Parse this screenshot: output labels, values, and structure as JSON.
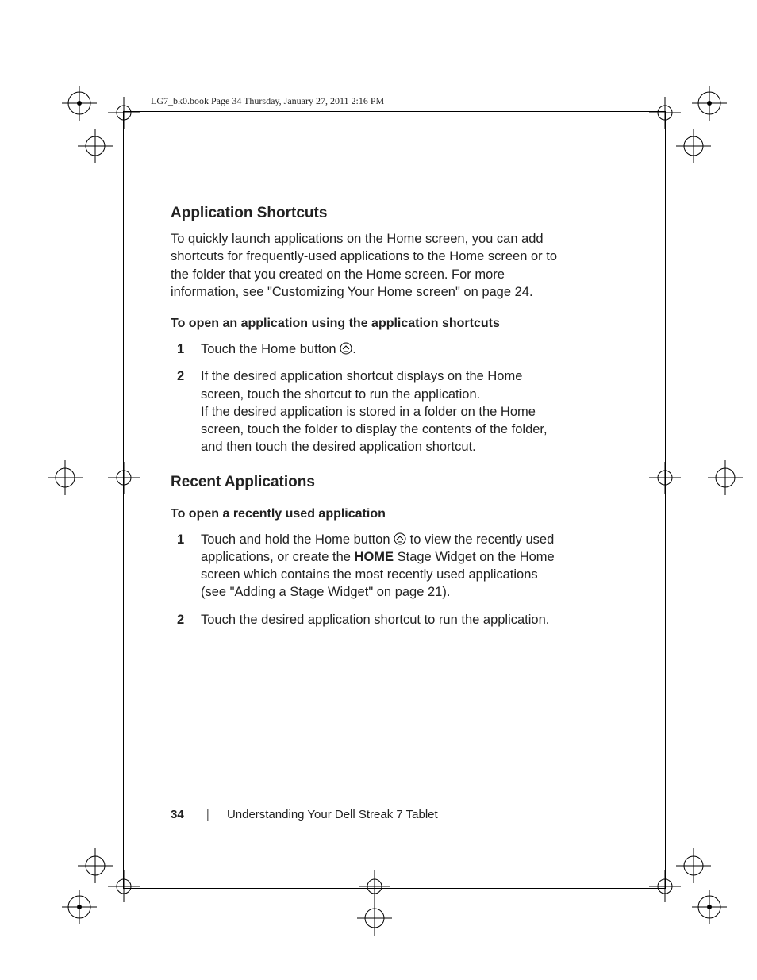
{
  "running_header": "LG7_bk0.book  Page 34  Thursday, January 27, 2011  2:16 PM",
  "sections": {
    "app_shortcuts": {
      "heading": "Application Shortcuts",
      "intro": "To quickly launch applications on the Home screen, you can add shortcuts for frequently-used applications to the Home screen or to the folder that you created on the Home screen. For more information, see \"Customizing Your Home screen\" on page 24.",
      "sub1": {
        "heading": "To open an application using the application shortcuts",
        "steps": [
          {
            "num": "1",
            "pre": "Touch the Home button ",
            "post": "."
          },
          {
            "num": "2",
            "para1": "If the desired application shortcut displays on the Home screen, touch the shortcut to run the application.",
            "para2": "If the desired application is stored in a folder on the Home screen, touch the folder to display the contents of the folder, and then touch the desired application shortcut."
          }
        ]
      }
    },
    "recent_apps": {
      "heading": "Recent Applications",
      "sub1": {
        "heading": "To open a recently used application",
        "steps": [
          {
            "num": "1",
            "pre": "Touch and hold the Home button ",
            "post_a": " to view the recently used applications, or create the ",
            "bold": "HOME",
            "post_b": " Stage Widget on the Home screen which contains the most recently used applications (see \"Adding a Stage Widget\" on page 21)."
          },
          {
            "num": "2",
            "text": "Touch the desired application shortcut to run the application."
          }
        ]
      }
    }
  },
  "footer": {
    "page_number": "34",
    "separator": "|",
    "chapter": "Understanding Your Dell Streak 7 Tablet"
  }
}
